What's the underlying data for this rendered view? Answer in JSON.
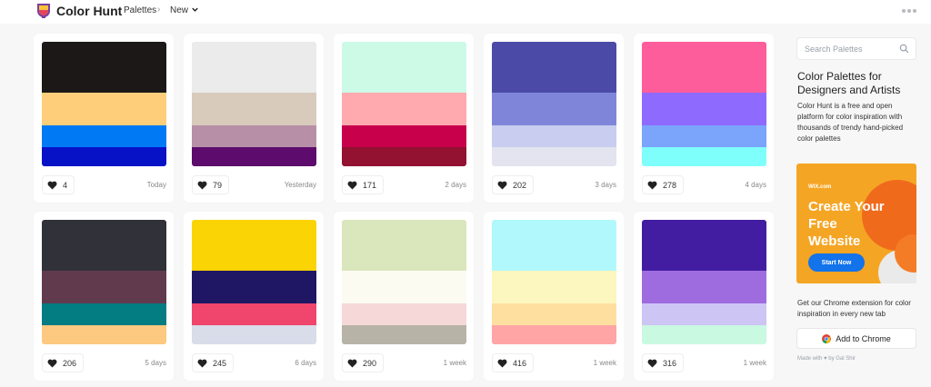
{
  "header": {
    "brand": "Color Hunt",
    "crumb_palettes": "Palettes",
    "crumb_sep": "›",
    "crumb_new": "New"
  },
  "palettes": [
    {
      "colors": [
        "#1b1817",
        "#ffce7b",
        "#0079f5",
        "#0712c7"
      ],
      "likes": "4",
      "age": "Today"
    },
    {
      "colors": [
        "#ebebeb",
        "#d8cbbc",
        "#b78fa7",
        "#5d0b6c"
      ],
      "likes": "79",
      "age": "Yesterday"
    },
    {
      "colors": [
        "#ccfae7",
        "#ffaaae",
        "#c8004c",
        "#931131"
      ],
      "likes": "171",
      "age": "2 days"
    },
    {
      "colors": [
        "#4b4ba7",
        "#7f86d9",
        "#c9cdef",
        "#e3e4ef"
      ],
      "likes": "202",
      "age": "3 days"
    },
    {
      "colors": [
        "#fe5d9b",
        "#8f6afe",
        "#7ba4fb",
        "#7efffb"
      ],
      "likes": "278",
      "age": "4 days"
    },
    {
      "colors": [
        "#31313a",
        "#613a4e",
        "#037c82",
        "#fdc87f"
      ],
      "likes": "206",
      "age": "5 days"
    },
    {
      "colors": [
        "#fad405",
        "#1f1764",
        "#f0456c",
        "#d9dce9"
      ],
      "likes": "245",
      "age": "6 days"
    },
    {
      "colors": [
        "#dae6bb",
        "#fcfbf2",
        "#f6d8d8",
        "#b7b3a6"
      ],
      "likes": "290",
      "age": "1 week"
    },
    {
      "colors": [
        "#b1f8fc",
        "#fcf6bf",
        "#ffdf9f",
        "#ffa5a6"
      ],
      "likes": "416",
      "age": "1 week"
    },
    {
      "colors": [
        "#421da1",
        "#9f6ce0",
        "#cdc5f4",
        "#c9f9e1"
      ],
      "likes": "316",
      "age": "1 week"
    }
  ],
  "sidebar": {
    "search_placeholder": "Search Palettes",
    "title": "Color Palettes for Designers and Artists",
    "description": "Color Hunt is a free and open platform for color inspiration with thousands of trendy hand-picked color palettes",
    "ad_brand": "WIX.com",
    "ad_headline": "Create Your Free Website",
    "ad_button": "Start Now",
    "extension_text": "Get our Chrome extension for color inspiration in every new tab",
    "add_to_chrome": "Add to Chrome",
    "made_with": "Made with ♥ by Gal Shir"
  },
  "colors": {
    "ad_bg": "#f5a524",
    "ad_button": "#1273eb",
    "accent_heart": "#222222"
  }
}
